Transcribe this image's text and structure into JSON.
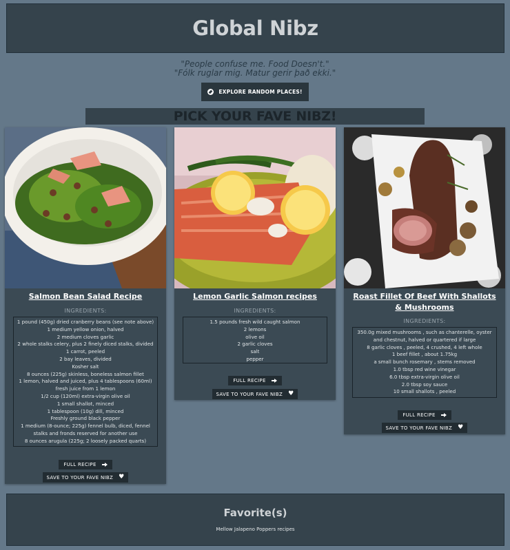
{
  "site": {
    "title": "Global Nibz",
    "quote_en": "\"People confuse me. Food Doesn't.\"",
    "quote_is": "\"Fólk ruglar mig. Matur gerir það ekki.\"",
    "explore_label": "EXPLORE RANDOM PLACES!",
    "pick_heading": "PICK YOUR FAVE NIBZ!"
  },
  "labels": {
    "ingredients": "INGREDIENTS:",
    "full_recipe": "FULL RECIPE",
    "save": "SAVE TO YOUR FAVE NIBZ"
  },
  "recipes": [
    {
      "title": "Salmon Bean Salad Recipe",
      "ingredients": [
        "1 pound (450g) dried cranberry beans (see note above)",
        "1 medium yellow onion, halved",
        "2 medium cloves garlic",
        "2 whole stalks celery, plus 2 finely diced stalks, divided",
        "1 carrot, peeled",
        "2 bay leaves, divided",
        "Kosher salt",
        "8 ounces (225g) skinless, boneless salmon fillet",
        "1 lemon, halved and juiced, plus 4 tablespoons (60ml)",
        "fresh juice from 1 lemon",
        "1/2 cup (120ml) extra-virgin olive oil",
        "1 small shallot, minced",
        "1 tablespoon (10g) dill, minced",
        "Freshly ground black pepper",
        "1 medium (8-ounce; 225g) fennel bulb, diced, fennel",
        "stalks and fronds reserved for another use",
        "8 ounces arugula (225g; 2 loosely packed quarts)"
      ]
    },
    {
      "title": "Lemon Garlic Salmon recipes",
      "ingredients": [
        "1.5 pounds fresh wild caught salmon",
        "2 lemons",
        "olive oil",
        "2 garlic cloves",
        "salt",
        "pepper"
      ]
    },
    {
      "title_line1": "Roast Fillet Of Beef With Shallots",
      "title_line2": "& Mushrooms",
      "ingredients": [
        "350.0g mixed mushrooms , such as chanterelle, oyster",
        "and chestnut, halved or quartered if large",
        "8 garlic cloves , peeled, 4 crushed, 4 left whole",
        "1 beef fillet , about 1.75kg",
        "a small bunch rosemary , stems removed",
        "1.0 tbsp red wine vinegar",
        "6.0 tbsp extra-virgin olive oil",
        "2.0 tbsp soy sauce",
        "10 small shallots , peeled"
      ]
    }
  ],
  "favorites": {
    "heading": "Favorite(s)",
    "items": [
      "Mellow Jalapeno Poppers recipes"
    ]
  },
  "colors": {
    "page_bg": "#647889",
    "panel_bg": "#35434c",
    "card_bg": "#3b4a54",
    "button_bg": "#222c32"
  }
}
